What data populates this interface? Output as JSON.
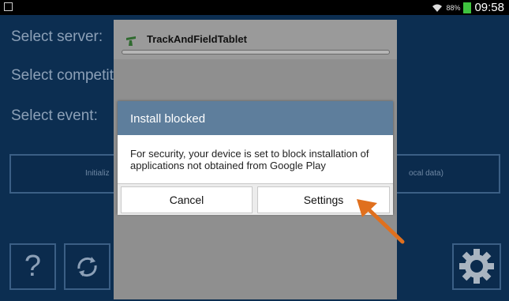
{
  "status_bar": {
    "gallery_icon": "image-icon",
    "wifi_icon": "wifi-icon",
    "battery_percent": "88%",
    "battery_icon": "battery-icon",
    "time": "09:58"
  },
  "main": {
    "labels": [
      "Select server:",
      "Select competit",
      "Select event:"
    ],
    "wide_button": {
      "left_text": "Initializ",
      "right_text": "ocal data)"
    },
    "help_button_label": "?",
    "refresh_icon": "refresh-icon",
    "settings_icon": "gear-icon"
  },
  "installer": {
    "app_icon": "app-icon",
    "title": "TrackAndFieldTablet"
  },
  "dialog": {
    "title": "Install blocked",
    "message": "For security, your device is set to block installation of applications not obtained from Google Play",
    "cancel_label": "Cancel",
    "settings_label": "Settings"
  },
  "annotation": {
    "arrow_color": "#e0701e"
  }
}
